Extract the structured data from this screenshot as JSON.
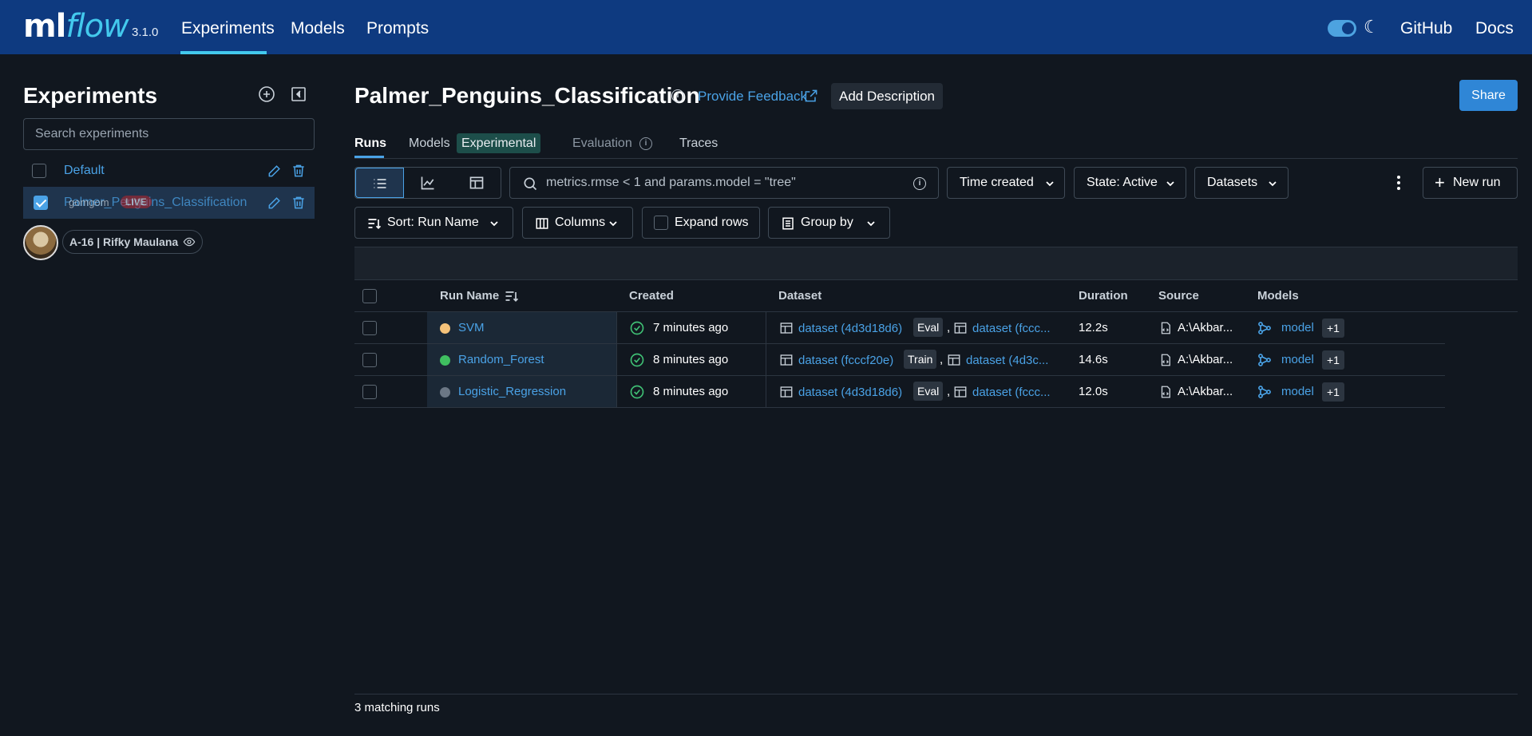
{
  "nav": {
    "logo_ml": "ml",
    "logo_flow": "flow",
    "version": "3.1.0",
    "items": [
      "Experiments",
      "Models",
      "Prompts"
    ],
    "github": "GitHub",
    "docs": "Docs",
    "accent_color": "#43c9ed",
    "bg_color": "#0e3a80"
  },
  "sidebar": {
    "title": "Experiments",
    "search_placeholder": "Search experiments",
    "experiments": [
      {
        "name": "Default",
        "checked": false
      },
      {
        "name": "Palmer_Penguins_Classification",
        "checked": true
      }
    ],
    "overlay_user": "gomgom",
    "overlay_live": "LIVE",
    "user_pill": "A-16 | Rifky Maulana"
  },
  "header": {
    "title": "Palmer_Penguins_Classification",
    "feedback": "Provide Feedback",
    "add_description": "Add Description",
    "share": "Share"
  },
  "tabs": {
    "runs": "Runs",
    "models": "Models",
    "experimental": "Experimental",
    "evaluation": "Evaluation",
    "traces": "Traces"
  },
  "toolbar": {
    "filter_placeholder": "metrics.rmse < 1 and params.model = \"tree\"",
    "time_created": "Time created",
    "state": "State: Active",
    "datasets": "Datasets",
    "new_run": "New run",
    "sort": "Sort: Run Name",
    "columns": "Columns",
    "expand_rows": "Expand rows",
    "group_by": "Group by"
  },
  "table": {
    "headers": [
      "Run Name",
      "Created",
      "Dataset",
      "Duration",
      "Source",
      "Models"
    ],
    "rows": [
      {
        "name": "SVM",
        "color": "#f5c27a",
        "created": "7 minutes ago",
        "ds1": "dataset (4d3d18d6)",
        "tag1": "Eval",
        "ds2": "dataset (fccc...",
        "duration": "12.2s",
        "source": "A:\\Akbar...",
        "model": "model",
        "extra": "+1"
      },
      {
        "name": "Random_Forest",
        "color": "#3fbf60",
        "created": "8 minutes ago",
        "ds1": "dataset (fcccf20e)",
        "tag1": "Train",
        "ds2": "dataset (4d3c...",
        "duration": "14.6s",
        "source": "A:\\Akbar...",
        "model": "model",
        "extra": "+1"
      },
      {
        "name": "Logistic_Regression",
        "color": "#6b7785",
        "created": "8 minutes ago",
        "ds1": "dataset (4d3d18d6)",
        "tag1": "Eval",
        "ds2": "dataset (fccc...",
        "duration": "12.0s",
        "source": "A:\\Akbar...",
        "model": "model",
        "extra": "+1"
      }
    ]
  },
  "footer": {
    "matching": "3 matching runs"
  }
}
